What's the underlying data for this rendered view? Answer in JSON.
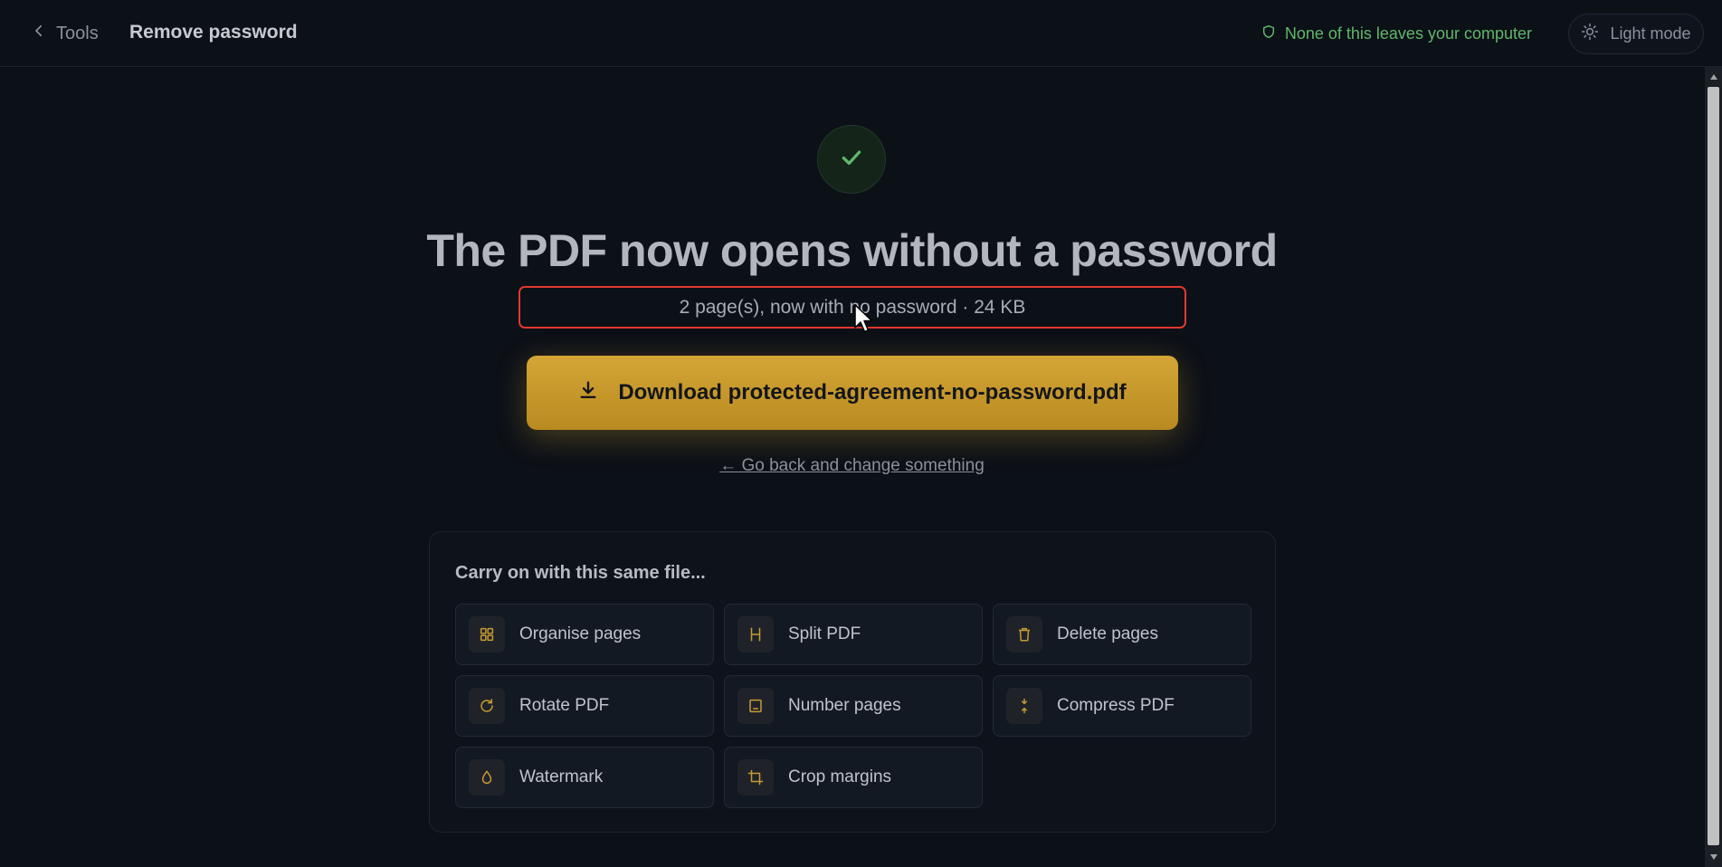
{
  "header": {
    "back_label": "Tools",
    "title": "Remove password",
    "privacy_note": "None of this leaves your computer",
    "theme_toggle_label": "Light mode"
  },
  "result": {
    "headline": "The PDF now opens without a password",
    "summary": "2 page(s), now with no password · 24 KB",
    "download_label": "Download protected-agreement-no-password.pdf",
    "change_link": "← Go back and change something"
  },
  "next_steps": {
    "title": "Carry on with this same file...",
    "tools": [
      {
        "label": "Organise pages",
        "icon": "grid-icon"
      },
      {
        "label": "Split PDF",
        "icon": "split-icon"
      },
      {
        "label": "Delete pages",
        "icon": "trash-icon"
      },
      {
        "label": "Rotate PDF",
        "icon": "rotate-icon"
      },
      {
        "label": "Number pages",
        "icon": "page-number-icon"
      },
      {
        "label": "Compress PDF",
        "icon": "compress-icon"
      },
      {
        "label": "Watermark",
        "icon": "droplet-icon"
      },
      {
        "label": "Crop margins",
        "icon": "crop-icon"
      }
    ]
  },
  "colors": {
    "background": "#0c1017",
    "accent_gold": "#d4a636",
    "success_green": "#5fb86a",
    "highlight_red": "#e03a2f"
  }
}
